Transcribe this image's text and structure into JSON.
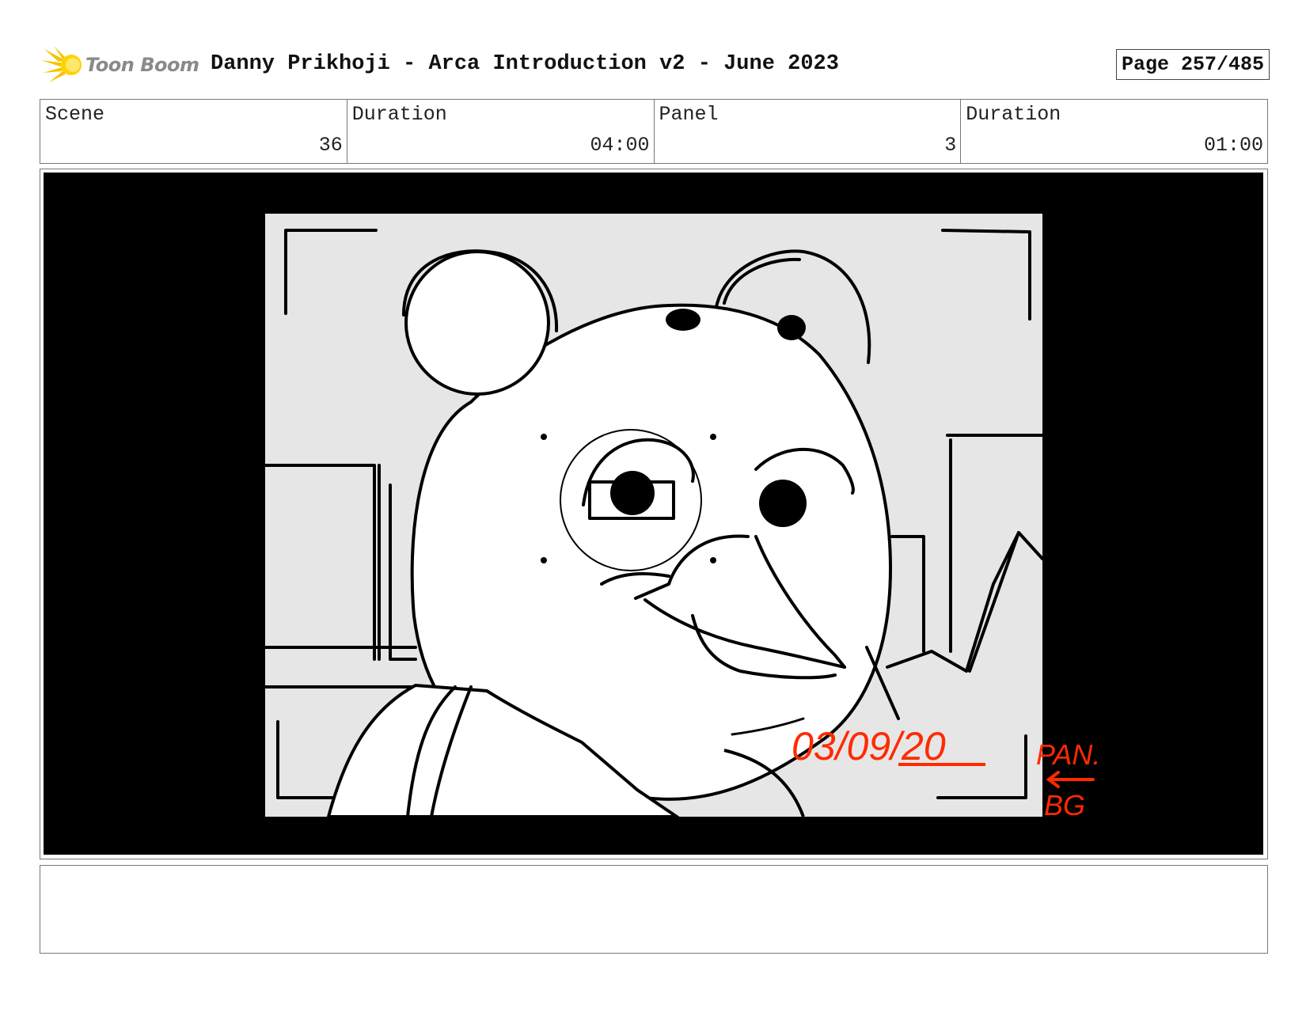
{
  "header": {
    "logo_text": "Toon Boom",
    "title": "Danny Prikhoji - Arca Introduction v2 - June 2023",
    "page_label": "Page 257/485"
  },
  "info": {
    "scene_label": "Scene",
    "scene_value": "36",
    "scene_duration_label": "Duration",
    "scene_duration_value": "04:00",
    "panel_label": "Panel",
    "panel_value": "3",
    "panel_duration_label": "Duration",
    "panel_duration_value": "01:00"
  },
  "panel": {
    "date_annotation": "03/09/20",
    "note_line1": "PAN.",
    "note_line2": "BG",
    "annotation_color": "#ff2a00"
  },
  "notes": {
    "text": ""
  }
}
